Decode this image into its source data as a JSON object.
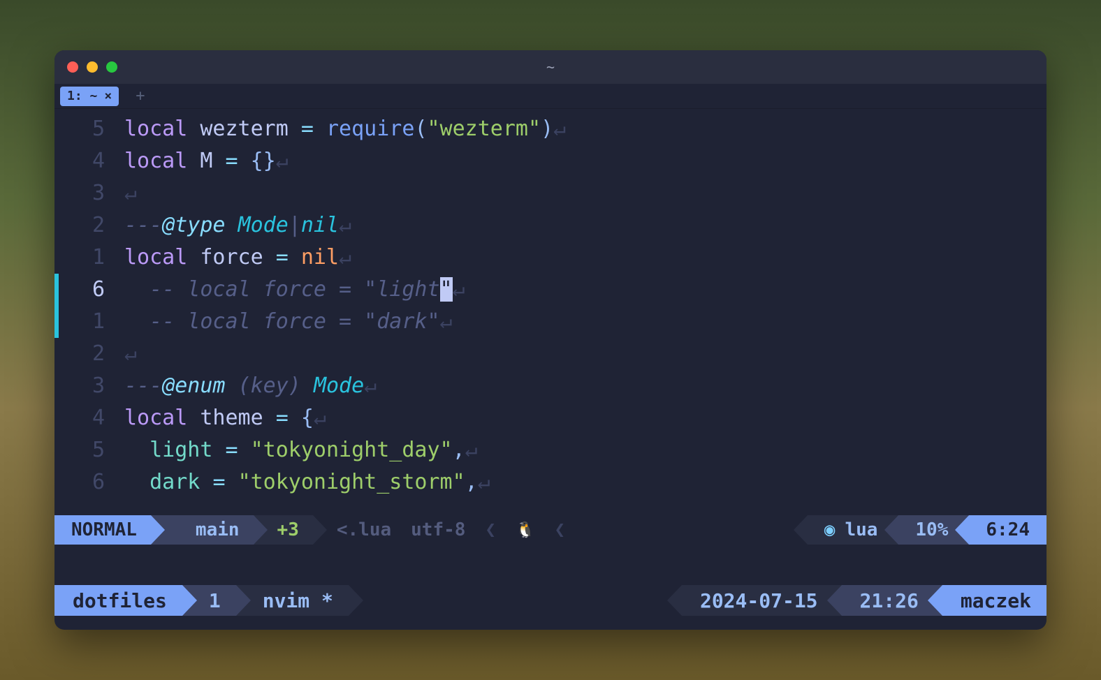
{
  "titlebar": {
    "title": "~"
  },
  "traffic": {
    "close": "close",
    "min": "minimize",
    "max": "maximize"
  },
  "tab": {
    "label": "1: ~",
    "close": "×",
    "new": "+"
  },
  "lines": [
    {
      "num": "5",
      "tokens": [
        {
          "cls": "kw",
          "t": "local"
        },
        {
          "cls": "var",
          "t": " wezterm "
        },
        {
          "cls": "op",
          "t": "="
        },
        {
          "cls": "var",
          "t": " "
        },
        {
          "cls": "fn",
          "t": "require"
        },
        {
          "cls": "punc",
          "t": "("
        },
        {
          "cls": "str",
          "t": "\"wezterm\""
        },
        {
          "cls": "punc",
          "t": ")"
        },
        {
          "cls": "eol",
          "t": "↵"
        }
      ]
    },
    {
      "num": "4",
      "tokens": [
        {
          "cls": "kw",
          "t": "local"
        },
        {
          "cls": "var",
          "t": " M "
        },
        {
          "cls": "op",
          "t": "="
        },
        {
          "cls": "var",
          "t": " "
        },
        {
          "cls": "punc",
          "t": "{}"
        },
        {
          "cls": "eol",
          "t": "↵"
        }
      ]
    },
    {
      "num": "3",
      "tokens": [
        {
          "cls": "eol",
          "t": "↵"
        }
      ]
    },
    {
      "num": "2",
      "tokens": [
        {
          "cls": "cmtprefix",
          "t": "---"
        },
        {
          "cls": "doc-tag",
          "t": "@type "
        },
        {
          "cls": "doc-type",
          "t": "Mode"
        },
        {
          "cls": "doc-text",
          "t": "|"
        },
        {
          "cls": "doc-type",
          "t": "nil"
        },
        {
          "cls": "eol",
          "t": "↵"
        }
      ]
    },
    {
      "num": "1",
      "tokens": [
        {
          "cls": "kw",
          "t": "local"
        },
        {
          "cls": "var",
          "t": " force "
        },
        {
          "cls": "op",
          "t": "="
        },
        {
          "cls": "var",
          "t": " "
        },
        {
          "cls": "const",
          "t": "nil"
        },
        {
          "cls": "eol",
          "t": "↵"
        }
      ]
    },
    {
      "num": "6",
      "current": true,
      "hl": true,
      "tokens": [
        {
          "cls": "cmt",
          "t": "  -- local force = \"light"
        },
        {
          "cls": "cursor",
          "t": "\""
        },
        {
          "cls": "eol",
          "t": "↵"
        }
      ]
    },
    {
      "num": "1",
      "hl": true,
      "tokens": [
        {
          "cls": "cmt",
          "t": "  -- local force = \"dark\""
        },
        {
          "cls": "eol",
          "t": "↵"
        }
      ]
    },
    {
      "num": "2",
      "tokens": [
        {
          "cls": "eol",
          "t": "↵"
        }
      ]
    },
    {
      "num": "3",
      "tokens": [
        {
          "cls": "cmtprefix",
          "t": "---"
        },
        {
          "cls": "doc-tag",
          "t": "@enum "
        },
        {
          "cls": "doc-text",
          "t": "(key) "
        },
        {
          "cls": "doc-type",
          "t": "Mode"
        },
        {
          "cls": "eol",
          "t": "↵"
        }
      ]
    },
    {
      "num": "4",
      "tokens": [
        {
          "cls": "kw",
          "t": "local"
        },
        {
          "cls": "var",
          "t": " theme "
        },
        {
          "cls": "op",
          "t": "="
        },
        {
          "cls": "var",
          "t": " "
        },
        {
          "cls": "punc",
          "t": "{"
        },
        {
          "cls": "eol",
          "t": "↵"
        }
      ]
    },
    {
      "num": "5",
      "tokens": [
        {
          "cls": "var",
          "t": "  "
        },
        {
          "cls": "ident",
          "t": "light"
        },
        {
          "cls": "var",
          "t": " "
        },
        {
          "cls": "op",
          "t": "="
        },
        {
          "cls": "var",
          "t": " "
        },
        {
          "cls": "str",
          "t": "\"tokyonight_day\""
        },
        {
          "cls": "punc",
          "t": ","
        },
        {
          "cls": "eol",
          "t": "↵"
        }
      ]
    },
    {
      "num": "6",
      "tokens": [
        {
          "cls": "var",
          "t": "  "
        },
        {
          "cls": "ident",
          "t": "dark"
        },
        {
          "cls": "var",
          "t": " "
        },
        {
          "cls": "op",
          "t": "="
        },
        {
          "cls": "var",
          "t": " "
        },
        {
          "cls": "str",
          "t": "\"tokyonight_storm\""
        },
        {
          "cls": "punc",
          "t": ","
        },
        {
          "cls": "eol",
          "t": "↵"
        }
      ]
    }
  ],
  "status": {
    "mode": "NORMAL",
    "branch": "main",
    "diff": "+3",
    "file_icon": "<",
    "filetype_short": ".lua",
    "encoding": "utf-8",
    "os": "linux",
    "lang": "lua",
    "percent": "10%",
    "pos": "6:24"
  },
  "tmux": {
    "session": "dotfiles",
    "winnum": "1",
    "winname": "nvim *",
    "date": "2024-07-15",
    "time": "21:26",
    "user": "maczek"
  }
}
